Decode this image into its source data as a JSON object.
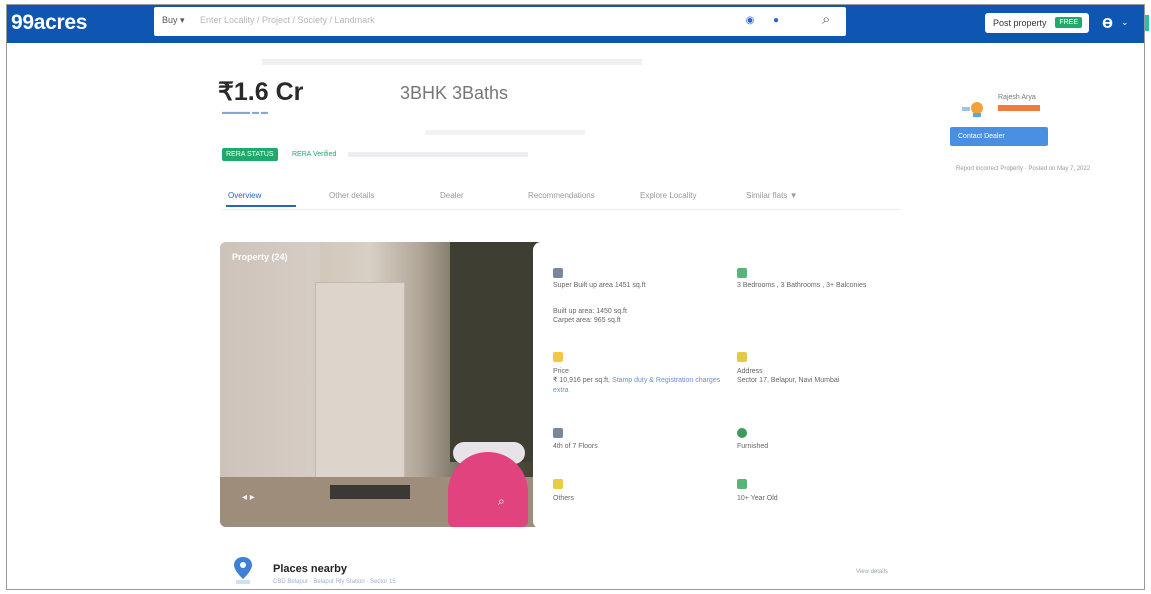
{
  "header": {
    "logo": "99acres",
    "search": {
      "buy_label": "Buy ▾",
      "placeholder": "Enter Locality / Project / Society / Landmark"
    },
    "post_property": {
      "label": "Post property",
      "badge": "FREE"
    }
  },
  "listing": {
    "price": "₹1.6 Cr",
    "configuration": "3BHK 3Baths",
    "badge": "RERA STATUS",
    "verified": "RERA Verified"
  },
  "tabs": [
    {
      "label": "Overview"
    },
    {
      "label": "Other details"
    },
    {
      "label": "Dealer"
    },
    {
      "label": "Recommendations"
    },
    {
      "label": "Explore Locality"
    },
    {
      "label": "Similar flats ▼"
    }
  ],
  "photo": {
    "label": "Property (24)"
  },
  "details": {
    "area": {
      "super": "Super Built up area 1451 sq.ft",
      "builtup": "Built up area: 1450 sq.ft",
      "carpet": "Carpet area: 965 sq.ft"
    },
    "config_value": "3 Bedrooms , 3 Bathrooms , 3+ Balconies",
    "price_label": "Price",
    "price_value": "₹ 10,916 per sq.ft,",
    "price_link": "Stamp duty & Registration charges",
    "price_extra": "extra",
    "address_label": "Address",
    "address_value": "Sector 17, Belapur, Navi Mumbai",
    "floor_value": "4th of 7 Floors",
    "facing_value": "Furnished",
    "overlooking_value": "Others",
    "age_value": "10+ Year Old"
  },
  "agent": {
    "name": "Rajesh Arya",
    "contact_label": "Contact Dealer",
    "report": "Report incorrect Property · Posted on May 7, 2022"
  },
  "places": {
    "title": "Places nearby",
    "subtitle": "CBD Belapur · Belapur Rly Station · Sector 15",
    "view_details": "View details"
  },
  "colors": {
    "header_bg": "#0f56b3",
    "accent": "#2266c8",
    "green": "#1fa96b",
    "orange": "#f07b3a"
  }
}
